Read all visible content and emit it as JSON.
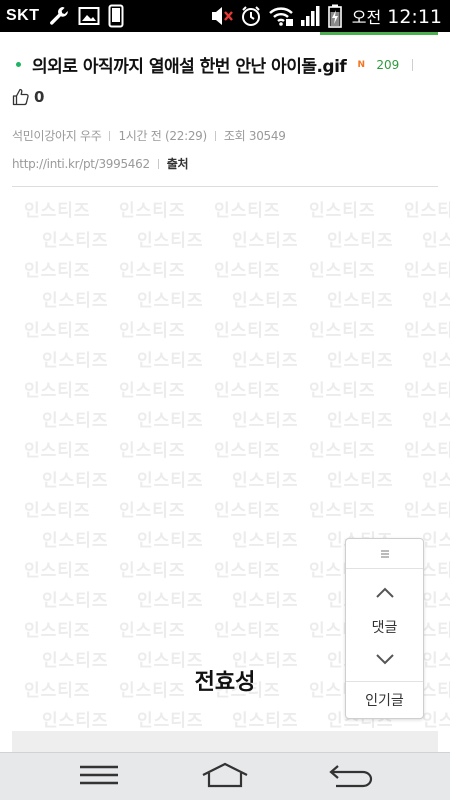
{
  "status_bar": {
    "carrier": "SKT",
    "ampm": "오전",
    "time": "12:11",
    "icons": [
      "wrench-icon",
      "image-icon",
      "phone-icon",
      "mute-icon",
      "alarm-icon",
      "wifi-icon",
      "signal-icon",
      "battery-charging-icon"
    ]
  },
  "post": {
    "title": "의외로 아직까지 열애설 한번 안난 아이돌.gif",
    "new_badge": "N",
    "comment_count": "209",
    "like_count": "0",
    "author": "석민이강아지 우주",
    "time_ago": "1시간 전 (22:29)",
    "views": "조회 30549",
    "short_link": "http://inti.kr/pt/3995462",
    "source_label": "출처"
  },
  "content": {
    "watermark": "인스티즈",
    "caption": "전효성"
  },
  "float_nav": {
    "comment_label": "댓글",
    "popular_label": "인기글"
  },
  "nav_bar": {
    "icons": [
      "menu-icon",
      "home-icon",
      "back-icon"
    ]
  },
  "colors": {
    "accent_green": "#1fb463",
    "count_green": "#2e9b3e",
    "new_orange": "#f47521"
  }
}
